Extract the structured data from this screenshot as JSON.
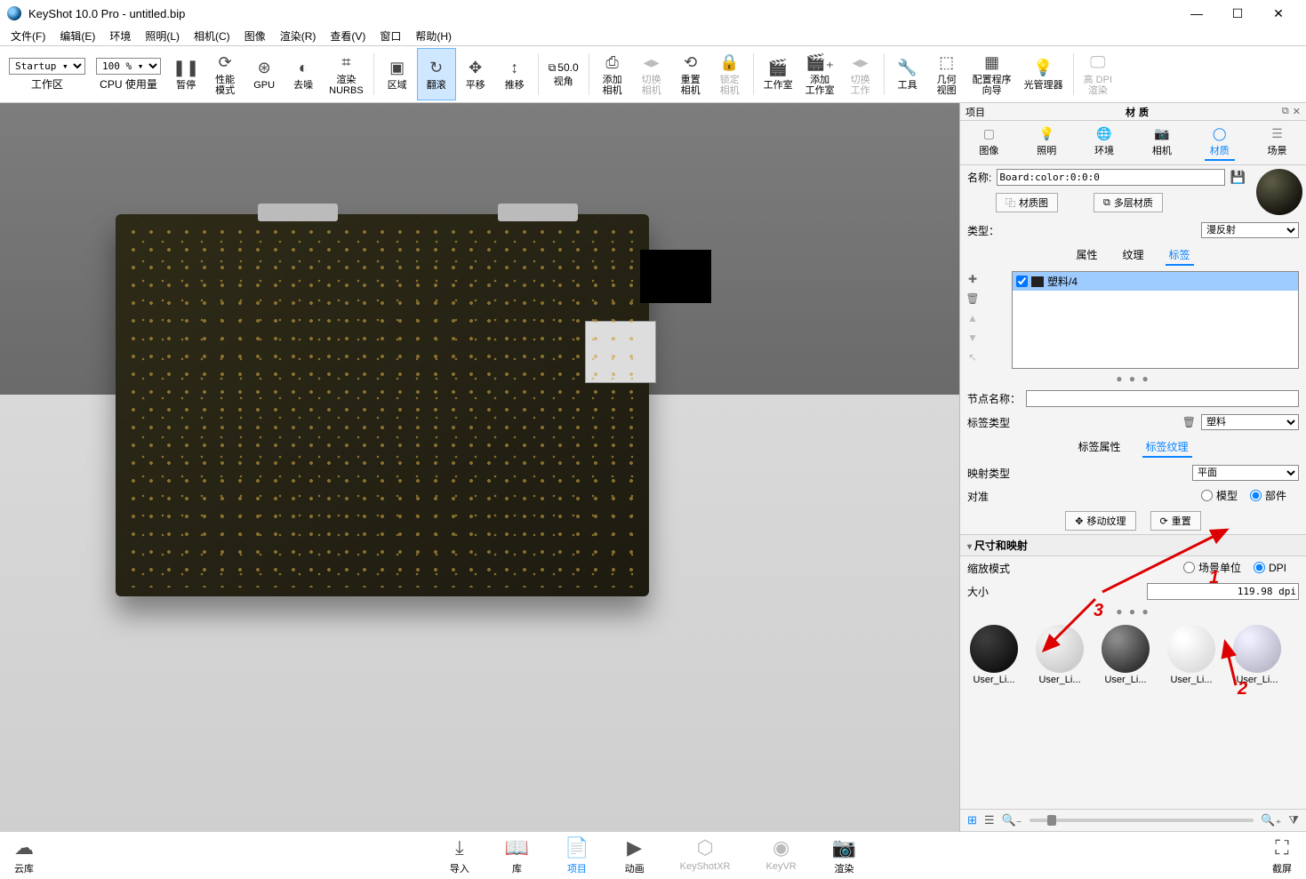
{
  "title": "KeyShot 10.0 Pro  - untitled.bip",
  "menu": [
    "文件(F)",
    "编辑(E)",
    "环境",
    "照明(L)",
    "相机(C)",
    "图像",
    "渲染(R)",
    "查看(V)",
    "窗口",
    "帮助(H)"
  ],
  "toolbar": {
    "startup": "Startup",
    "zoom": "100 %",
    "items": [
      {
        "id": "workspace",
        "label": "工作区",
        "combo": true
      },
      {
        "id": "cpu",
        "label": "CPU 使用量",
        "combo": true
      },
      {
        "id": "pause",
        "label": "暂停",
        "icon": "❚❚"
      },
      {
        "id": "perf",
        "label": "性能\n模式",
        "icon": "⟳"
      },
      {
        "id": "gpu",
        "label": "GPU",
        "icon": "⊛"
      },
      {
        "id": "denoise",
        "label": "去噪",
        "icon": "◐"
      },
      {
        "id": "nurbs",
        "label": "渲染\nNURBS",
        "icon": "⌗"
      },
      {
        "id": "region",
        "label": "区域",
        "icon": "▣"
      },
      {
        "id": "tumble",
        "label": "翻滚",
        "icon": "↻",
        "active": true
      },
      {
        "id": "pan",
        "label": "平移",
        "icon": "✥"
      },
      {
        "id": "dolly",
        "label": "推移",
        "icon": "↕"
      },
      {
        "id": "fov_combo",
        "label": "视角",
        "combo2": true,
        "v1": "⧉",
        "v2": "50.0"
      },
      {
        "id": "addcam",
        "label": "添加\n相机",
        "icon": "⎙"
      },
      {
        "id": "switchcam",
        "label": "切换\n相机",
        "icon": "◂▸",
        "disabled": true
      },
      {
        "id": "resetcam",
        "label": "重置\n相机",
        "icon": "⟲"
      },
      {
        "id": "lockcam",
        "label": "锁定\n相机",
        "icon": "🔒",
        "disabled": true
      },
      {
        "id": "studio",
        "label": "工作室",
        "icon": "🎬"
      },
      {
        "id": "addstudio",
        "label": "添加\n工作室",
        "icon": "🎬₊"
      },
      {
        "id": "switchstudio",
        "label": "切换\n工作",
        "icon": "◂▸",
        "disabled": true
      },
      {
        "id": "tools",
        "label": "工具",
        "icon": "🔧"
      },
      {
        "id": "geomview",
        "label": "几何\n视图",
        "icon": "⬚"
      },
      {
        "id": "configurator",
        "label": "配置程序\n向导",
        "icon": "▦"
      },
      {
        "id": "lightmgr",
        "label": "光管理器",
        "icon": "💡"
      },
      {
        "id": "hidpi",
        "label": "高 DPI\n渲染",
        "icon": "🖵",
        "disabled": true
      }
    ]
  },
  "panel": {
    "headLeft": "项目",
    "headTitle": "材质",
    "tabs": [
      {
        "id": "image",
        "label": "图像",
        "icon": "▢"
      },
      {
        "id": "lighting",
        "label": "照明",
        "icon": "💡"
      },
      {
        "id": "env",
        "label": "环境",
        "icon": "🌐"
      },
      {
        "id": "camera",
        "label": "相机",
        "icon": "📷"
      },
      {
        "id": "material",
        "label": "材质",
        "icon": "◯",
        "active": true
      },
      {
        "id": "scene",
        "label": "场景",
        "icon": "☰"
      }
    ],
    "nameLabel": "名称:",
    "nameValue": "Board:color:0:0:0",
    "matGraphBtn": "材质图",
    "multiLayerBtn": "多层材质",
    "typeLabel": "类型：",
    "typeValue": "漫反射",
    "subtabs": [
      {
        "id": "props",
        "label": "属性"
      },
      {
        "id": "texture",
        "label": "纹理"
      },
      {
        "id": "labels",
        "label": "标签",
        "active": true
      }
    ],
    "listItem": "塑料/4",
    "nodeNameLabel": "节点名称：",
    "nodeNameValue": "",
    "labelTypeLabel": "标签类型",
    "labelTypeValue": "塑料",
    "subtabs2": [
      {
        "id": "labelprops",
        "label": "标签属性"
      },
      {
        "id": "labeltex",
        "label": "标签纹理",
        "active": true
      }
    ],
    "mappingTypeLabel": "映射类型",
    "mappingTypeValue": "平面",
    "alignLabel": "对准",
    "alignOptions": [
      {
        "id": "model",
        "label": "模型",
        "checked": false
      },
      {
        "id": "part",
        "label": "部件",
        "checked": true
      }
    ],
    "moveTexBtn": "移动纹理",
    "resetBtn": "重置",
    "sectionTitle": "尺寸和映射",
    "scaleModeLabel": "缩放模式",
    "scaleOptions": [
      {
        "id": "sceneunit",
        "label": "场景单位",
        "checked": false
      },
      {
        "id": "dpi",
        "label": "DPI",
        "checked": true
      }
    ],
    "sizeLabel": "大小",
    "sizeValue": "119.98 dpi",
    "swatches": [
      {
        "label": "User_Li...",
        "c1": "#3a3a3a",
        "c2": "#111"
      },
      {
        "label": "User_Li...",
        "c1": "#f4f4f4",
        "c2": "#ccc"
      },
      {
        "label": "User_Li...",
        "c1": "#888",
        "c2": "#333"
      },
      {
        "label": "User_Li...",
        "c1": "#fff",
        "c2": "#ddd"
      },
      {
        "label": "User_Li...",
        "c1": "#eef",
        "c2": "#bbc"
      }
    ]
  },
  "annotations": {
    "a1": "1",
    "a2": "2",
    "a3": "3"
  },
  "bottom": {
    "left": {
      "label": "云库",
      "icon": "☁"
    },
    "center": [
      {
        "id": "import",
        "label": "导入",
        "icon": "⤓"
      },
      {
        "id": "library",
        "label": "库",
        "icon": "📖"
      },
      {
        "id": "project",
        "label": "项目",
        "icon": "📄",
        "active": true
      },
      {
        "id": "anim",
        "label": "动画",
        "icon": "▶"
      },
      {
        "id": "ksxr",
        "label": "KeyShotXR",
        "icon": "⬡",
        "disabled": true
      },
      {
        "id": "keyvr",
        "label": "KeyVR",
        "icon": "◉",
        "disabled": true
      },
      {
        "id": "render",
        "label": "渲染",
        "icon": "📷"
      }
    ],
    "right": {
      "label": "截屏",
      "icon": "⛶"
    }
  }
}
